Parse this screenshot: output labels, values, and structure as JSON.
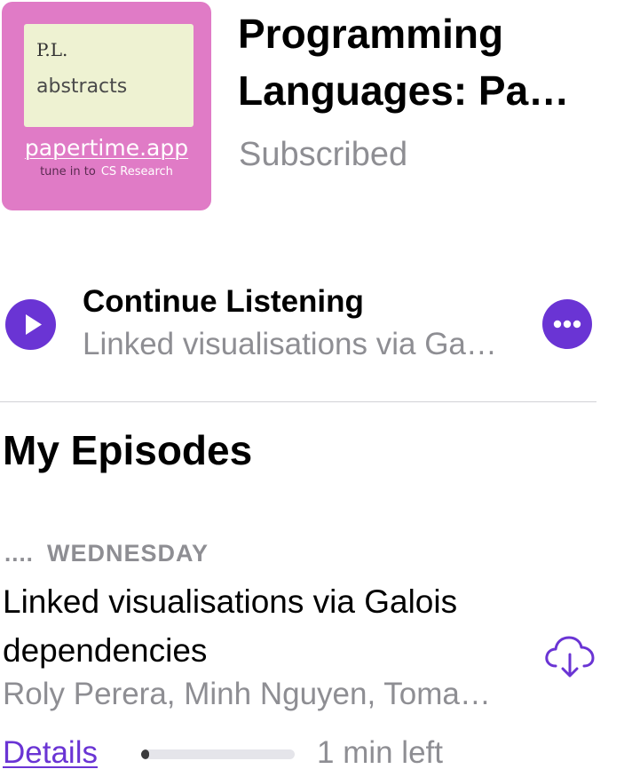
{
  "colors": {
    "accent": "#6a34d4",
    "secondary_text": "#8e8e93",
    "artwork_background": "#e07bc6",
    "artwork_card": "#eef2d2"
  },
  "artwork": {
    "line1": "P.L.",
    "line2": "abstracts",
    "brand": "papertime.app",
    "tagline_prefix": "tune in to",
    "tagline_topic": "CS Research"
  },
  "podcast": {
    "title_line1": "Programming",
    "title_line2": "Languages: Pa…",
    "status": "Subscribed"
  },
  "continue_listening": {
    "title": "Continue Listening",
    "episode": "Linked visualisations via Ga…",
    "play_icon": "play-icon",
    "more_icon": "more-icon"
  },
  "section": {
    "title": "My Episodes"
  },
  "episode": {
    "dots": "....",
    "date": "WEDNESDAY",
    "title": "Linked visualisations via Galois dependencies",
    "authors": "Roly Perera, Minh Nguyen, Toma…",
    "download_icon": "cloud-download-icon",
    "details_label": "Details",
    "progress": 0.05,
    "time_left": "1 min left"
  }
}
